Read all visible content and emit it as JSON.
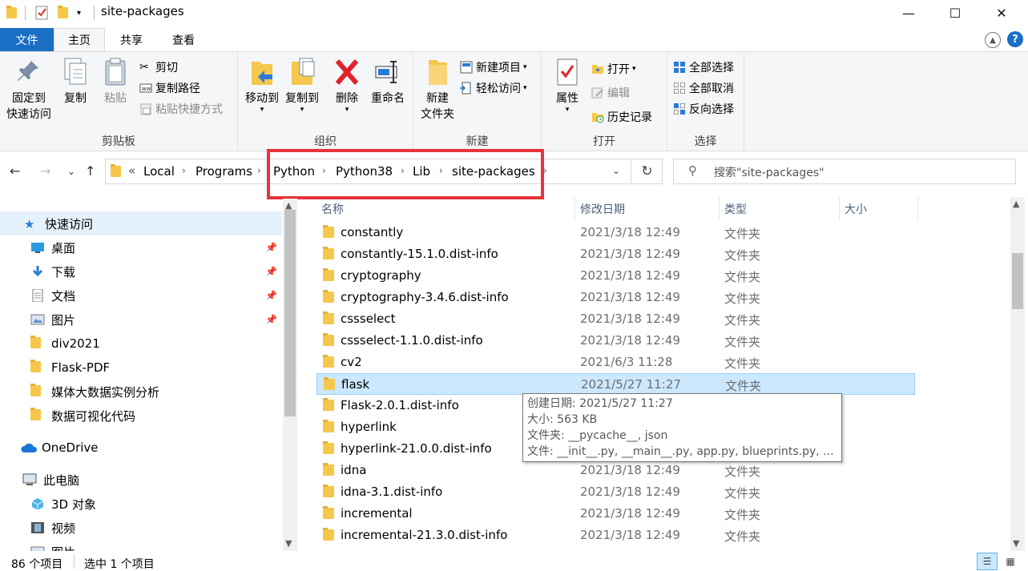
{
  "window": {
    "title": "site-packages",
    "minimize": "—",
    "maximize": "☐",
    "close": "✕"
  },
  "tabs": {
    "file": "文件",
    "home": "主页",
    "share": "共享",
    "view": "查看"
  },
  "ribbon": {
    "clipboard": {
      "title": "剪贴板",
      "pin_line1": "固定到",
      "pin_line2": "快速访问",
      "copy": "复制",
      "paste": "粘贴",
      "cut": "剪切",
      "copy_path": "复制路径",
      "paste_shortcut": "粘贴快捷方式"
    },
    "organize": {
      "title": "组织",
      "move_to": "移动到",
      "copy_to": "复制到",
      "delete": "删除",
      "rename": "重命名"
    },
    "new": {
      "title": "新建",
      "new_folder_line1": "新建",
      "new_folder_line2": "文件夹",
      "new_item": "新建项目",
      "easy_access": "轻松访问"
    },
    "open": {
      "title": "打开",
      "properties": "属性",
      "open": "打开",
      "edit": "编辑",
      "history": "历史记录"
    },
    "select": {
      "title": "选择",
      "select_all": "全部选择",
      "select_none": "全部取消",
      "invert": "反向选择"
    }
  },
  "address": {
    "overflow": "«",
    "crumbs": [
      "Local",
      "Programs",
      "Python",
      "Python38",
      "Lib",
      "site-packages"
    ],
    "search_placeholder": "搜索\"site-packages\""
  },
  "nav": {
    "quick_access": "快速访问",
    "desktop": "桌面",
    "downloads": "下载",
    "documents": "文档",
    "pictures": "图片",
    "div2021": "div2021",
    "flask_pdf": "Flask-PDF",
    "media_analysis": "媒体大数据实例分析",
    "viz_code": "数据可视化代码",
    "onedrive": "OneDrive",
    "this_pc": "此电脑",
    "objects3d": "3D 对象",
    "videos": "视频",
    "pictures2": "图片"
  },
  "columns": {
    "name": "名称",
    "date": "修改日期",
    "type": "类型",
    "size": "大小"
  },
  "files": [
    {
      "name": "constantly",
      "date": "2021/3/18 12:49",
      "type": "文件夹"
    },
    {
      "name": "constantly-15.1.0.dist-info",
      "date": "2021/3/18 12:49",
      "type": "文件夹"
    },
    {
      "name": "cryptography",
      "date": "2021/3/18 12:49",
      "type": "文件夹"
    },
    {
      "name": "cryptography-3.4.6.dist-info",
      "date": "2021/3/18 12:49",
      "type": "文件夹"
    },
    {
      "name": "cssselect",
      "date": "2021/3/18 12:49",
      "type": "文件夹"
    },
    {
      "name": "cssselect-1.1.0.dist-info",
      "date": "2021/3/18 12:49",
      "type": "文件夹"
    },
    {
      "name": "cv2",
      "date": "2021/6/3 11:28",
      "type": "文件夹"
    },
    {
      "name": "flask",
      "date": "2021/5/27 11:27",
      "type": "文件夹"
    },
    {
      "name": "Flask-2.0.1.dist-info",
      "date": "",
      "type": ""
    },
    {
      "name": "hyperlink",
      "date": "",
      "type": ""
    },
    {
      "name": "hyperlink-21.0.0.dist-info",
      "date": "",
      "type": ""
    },
    {
      "name": "idna",
      "date": "2021/3/18 12:49",
      "type": "文件夹"
    },
    {
      "name": "idna-3.1.dist-info",
      "date": "2021/3/18 12:49",
      "type": "文件夹"
    },
    {
      "name": "incremental",
      "date": "2021/3/18 12:49",
      "type": "文件夹"
    },
    {
      "name": "incremental-21.3.0.dist-info",
      "date": "2021/3/18 12:49",
      "type": "文件夹"
    }
  ],
  "tooltip": {
    "created": "创建日期: 2021/5/27 11:27",
    "size": "大小: 563 KB",
    "folders": "文件夹: __pycache__, json",
    "files": "文件: __init__.py, __main__.py, app.py, blueprints.py, ..."
  },
  "status": {
    "count": "86 个项目",
    "selected": "选中 1 个项目"
  },
  "colors": {
    "accent": "#1a6fc4",
    "highlight_box": "#e8333a",
    "selection": "#cce8ff",
    "folder": "#f5c84c"
  }
}
